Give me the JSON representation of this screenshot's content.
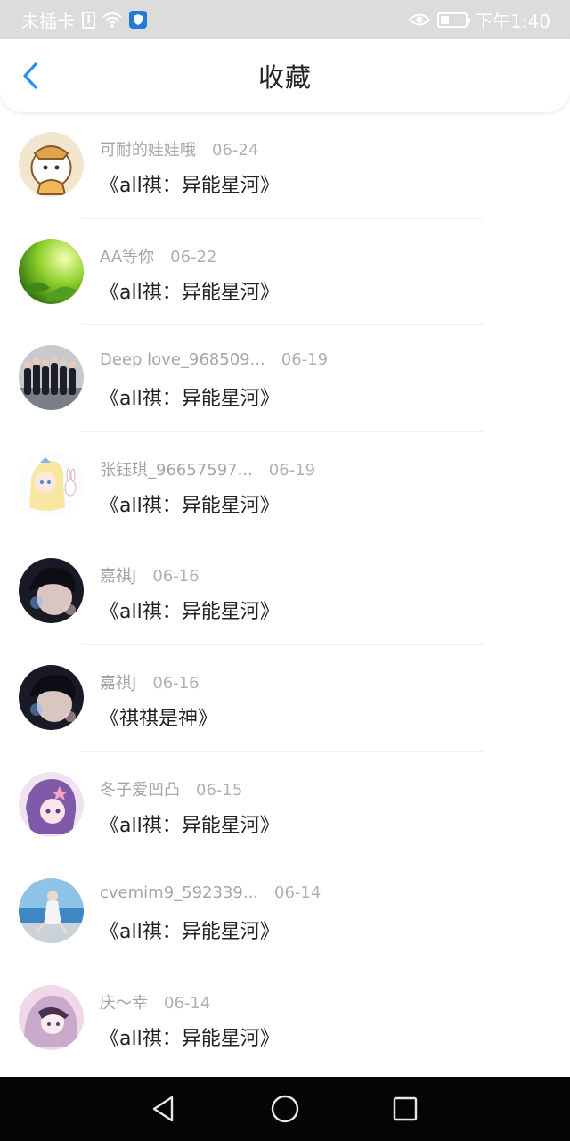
{
  "status_bar": {
    "carrier": "未插卡",
    "time": "下午1:40",
    "battery_level": 0.35,
    "icons": [
      "sim-alert-icon",
      "wifi-icon",
      "shield-icon",
      "eye-icon",
      "battery-icon"
    ]
  },
  "header": {
    "title": "收藏",
    "back_icon": "chevron-left-icon",
    "accent": "#2b8ef0"
  },
  "favorites": [
    {
      "user": "可耐的娃娃哦",
      "date": "06-24",
      "title": "《all祺：异能星河》",
      "avatar": "cartoon-bear"
    },
    {
      "user": "AA等你",
      "date": "06-22",
      "title": "《all祺：异能星河》",
      "avatar": "green-leaves"
    },
    {
      "user": "Deep love_968509...",
      "date": "06-19",
      "title": "《all祺：异能星河》",
      "avatar": "group-photo"
    },
    {
      "user": "张钰琪_96657597...",
      "date": "06-19",
      "title": "《all祺：异能星河》",
      "avatar": "anime-girl-rabbit"
    },
    {
      "user": "嘉祺J",
      "date": "06-16",
      "title": "《all祺：异能星河》",
      "avatar": "dark-portrait"
    },
    {
      "user": "嘉祺J",
      "date": "06-16",
      "title": "《祺祺是神》",
      "avatar": "dark-portrait"
    },
    {
      "user": "冬子爱凹凸",
      "date": "06-15",
      "title": "《all祺：异能星河》",
      "avatar": "anime-purple"
    },
    {
      "user": "cvemim9_592339...",
      "date": "06-14",
      "title": "《all祺：异能星河》",
      "avatar": "beach-photo"
    },
    {
      "user": "庆～幸",
      "date": "06-14",
      "title": "《all祺：异能星河》",
      "avatar": "anime-pink"
    }
  ],
  "nav_bar": {
    "icons": [
      "back-triangle-icon",
      "home-circle-icon",
      "recents-square-icon"
    ]
  }
}
